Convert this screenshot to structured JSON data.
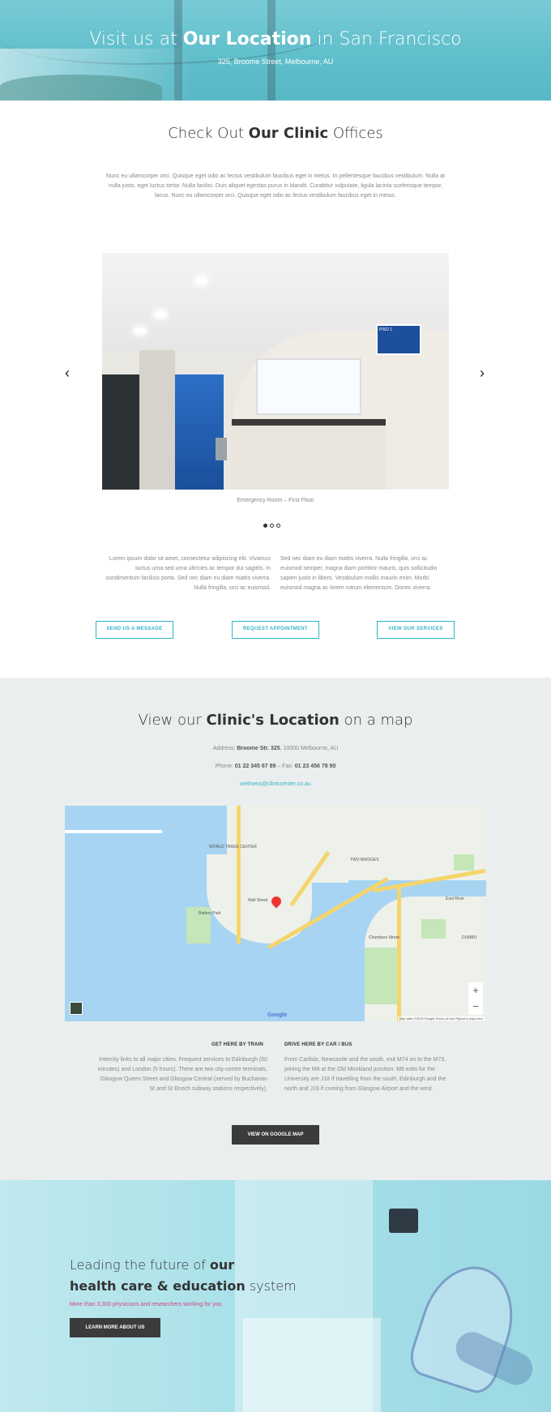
{
  "hero": {
    "title_pre": "Visit us at ",
    "title_bold": "Our Location",
    "title_post": " in San Francisco",
    "address": "325, Broome Street, Melbourne, AU"
  },
  "offices": {
    "heading_pre": "Check Out ",
    "heading_bold": "Our Clinic",
    "heading_post": " Offices",
    "intro": "Nunc eu ullamcorper orci. Quisque eget odio ac lectus vestibulum faucibus eget in metus. In pellentesque faucibus vestibulum. Nulla at nulla justo, eget luctus tortor. Nulla facilisi. Duis aliquet egestas purus in blandit. Curabitur vulputate, ligula lacinia scelerisque tempor, lacus. Nunc eu ullamcorper orci. Quisque eget odio ac lectus vestibulum faucibus eget in metus.",
    "slide_caption": "Emergency Room – First Floor",
    "sign_text": "PISO 1",
    "col_left": "Lorem ipsum dolor sit amet, consectetur adipiscing elit. Vivamus luctus urna sed urna ultricies ac tempor dui sagittis. In condimentum facilisis porta. Sed nec diam eu diam mattis viverra. Nulla fringilla, orci ac euismod.",
    "col_right": "Sed nec diam eu diam mattis viverra. Nulla fringilla, orci ac euismod semper, magna diam porttitor mauris, quis sollicitudin sapien justo in libero. Vestibulum mollis mauris enim. Morbi euismod magna ac lorem rutrum elementum. Donec viverra.",
    "buttons": [
      "SEND US A MESSAGE",
      "REQUEST APPOINTMENT",
      "VIEW OUR SERVICES"
    ]
  },
  "location": {
    "heading_pre": "View our ",
    "heading_bold": "Clinic's Location",
    "heading_post": " on a map",
    "address_label": "Address: ",
    "address_bold": "Broome Str. 325",
    "address_rest": ", 10000 Melbourne, AU",
    "phone_label": "Phone: ",
    "phone": "01 22 345 67 89",
    "fax_label": " – Fax: ",
    "fax": "01 23 456 78 90",
    "email": "wellness@cliniccenter.co.au",
    "map_labels": [
      "WORLD TRADE CENTER",
      "TWO BRIDGES",
      "DUMBO",
      "Battery Park",
      "Brooklyn Bridge Park",
      "Chambers Street",
      "Wall Street",
      "East River"
    ],
    "map_footer": "Map data ©2018 Google   Terms of Use   Report a map error",
    "google": "Google",
    "train_heading": "GET HERE BY TRAIN",
    "train_text": "Intercity links to all major cities. Frequent services to Edinburgh (50 minutes) and London (5 hours). There are two city-centre terminals, Glasgow Queen Street and Glasgow Central (served by Buchanan St and St Enoch subway stations respectively).",
    "car_heading": "DRIVE HERE BY CAR / BUS",
    "car_text": "From Carlisle, Newcastle and the south, exit M74 on to the M73, joining the M8 at the Old Monkland junction. M8 exits for the University are J18 if travelling from the south, Edinburgh and the north and J19 if coming from Glasgow Airport and the west.",
    "gmaps_button": "VIEW ON GOOGLE MAP"
  },
  "future": {
    "title_pre": "Leading the future of ",
    "title_bold1": "our",
    "title_bold2": "health care & education",
    "title_post": " system",
    "subtitle": "More than 3,300 physicians and researchers working for you",
    "button": "LEARN MORE ABOUT US"
  },
  "colors": {
    "accent": "#34b5c6",
    "dark_button": "#3a3b3d",
    "pink": "#d5457e"
  }
}
